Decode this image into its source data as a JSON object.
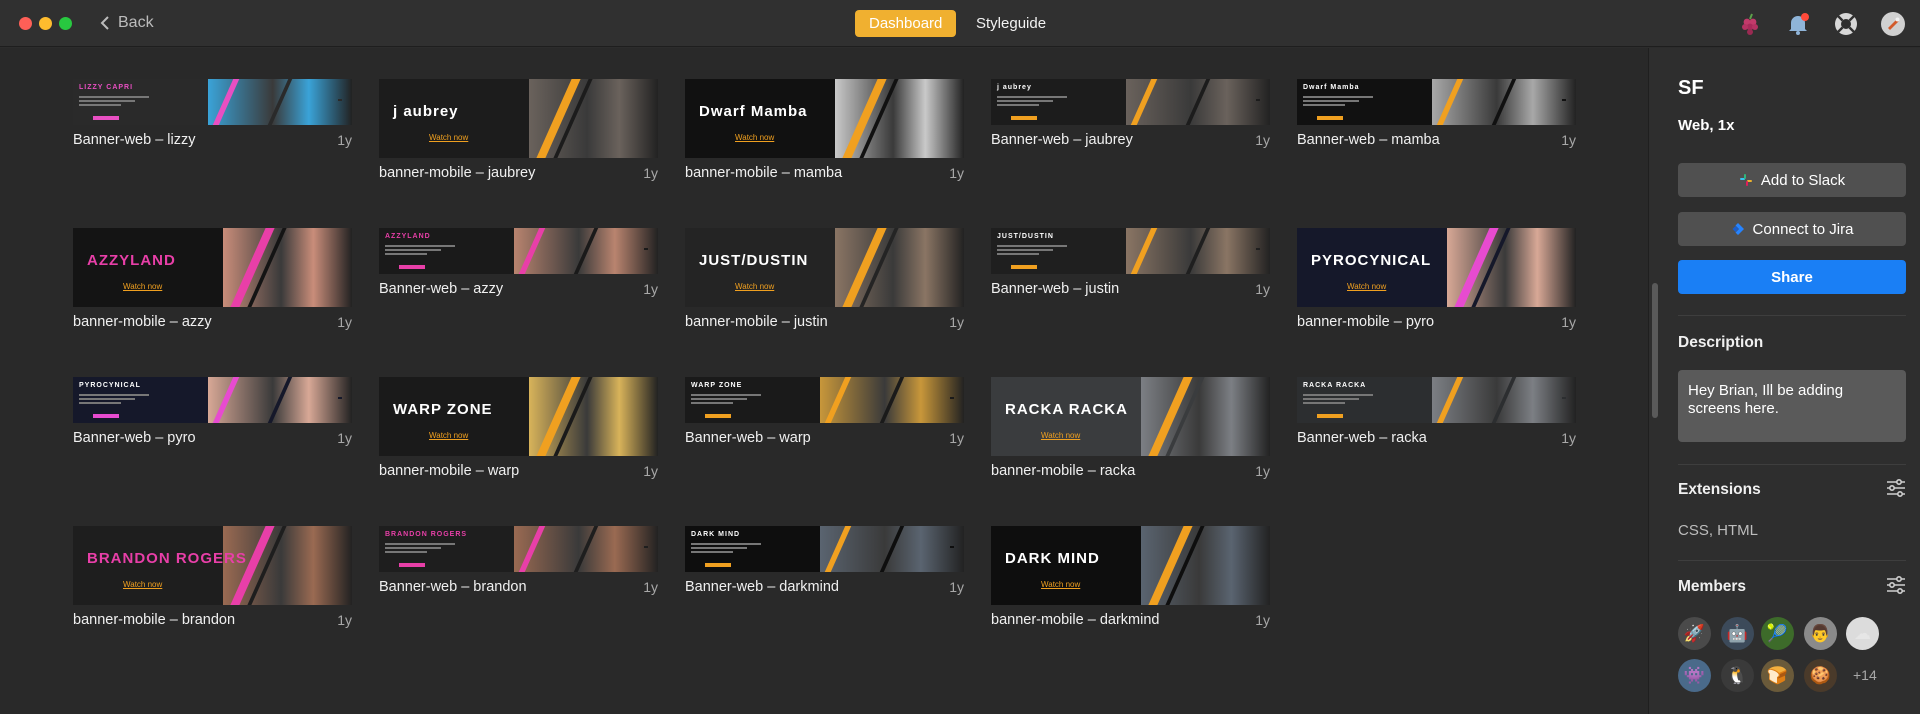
{
  "titlebar": {
    "back_label": "Back",
    "tabs": [
      {
        "label": "Dashboard",
        "active": true
      },
      {
        "label": "Styleguide",
        "active": false
      }
    ],
    "icons": [
      "grapes-icon",
      "notifications-icon",
      "help-lifebuoy-icon",
      "user-avatar-icon"
    ],
    "traffic_lights": [
      "#fe5f57",
      "#febc2e",
      "#28c840"
    ]
  },
  "grid": {
    "rows": [
      [
        {
          "name": "Banner-web – lizzy",
          "age": "1y",
          "kind": "web",
          "brand": "LIZZY CAPRI",
          "accent": "#e84fc2",
          "bg": "#2a2a2a",
          "photo": "#3aa3d8"
        },
        {
          "name": "banner-mobile – jaubrey",
          "age": "1y",
          "kind": "mobile",
          "brand": "j aubrey",
          "accent": "#f0a020",
          "bg": "#1c1c1c",
          "photo": "#6a625c",
          "watch": "Watch now"
        },
        {
          "name": "banner-mobile – mamba",
          "age": "1y",
          "kind": "mobile",
          "brand": "Dwarf Mamba",
          "accent": "#f0a020",
          "bg": "#111111",
          "photo": "#c9c9c9",
          "watch": "Watch now"
        },
        {
          "name": "Banner-web – jaubrey",
          "age": "1y",
          "kind": "web",
          "brand": "j aubrey",
          "accent": "#f0a020",
          "bg": "#1c1c1c",
          "photo": "#6a625c"
        },
        {
          "name": "Banner-web – mamba",
          "age": "1y",
          "kind": "web",
          "brand": "Dwarf Mamba",
          "accent": "#f0a020",
          "bg": "#111111",
          "photo": "#a8a8a8"
        }
      ],
      [
        {
          "name": "banner-mobile – azzy",
          "age": "1y",
          "kind": "mobile",
          "brand": "AZZYLAND",
          "accent": "#e83fa8",
          "bg": "#141414",
          "photo": "#c98d7a",
          "watch": "Watch now"
        },
        {
          "name": "Banner-web – azzy",
          "age": "1y",
          "kind": "web",
          "brand": "AZZYLAND",
          "accent": "#e83fa8",
          "bg": "#1a1a1a",
          "photo": "#b9846f"
        },
        {
          "name": "banner-mobile – justin",
          "age": "1y",
          "kind": "mobile",
          "brand": "JUST/DUSTIN",
          "accent": "#f0a020",
          "bg": "#242424",
          "photo": "#8a7564",
          "watch": "Watch now"
        },
        {
          "name": "Banner-web – justin",
          "age": "1y",
          "kind": "web",
          "brand": "JUST/DUSTIN",
          "accent": "#f0a020",
          "bg": "#1f1f1f",
          "photo": "#8a7564"
        },
        {
          "name": "banner-mobile – pyro",
          "age": "1y",
          "kind": "mobile",
          "brand": "PYROCYNICAL",
          "accent": "#e74bd0",
          "bg": "#15182a",
          "photo": "#d8a896",
          "watch": "Watch now"
        }
      ],
      [
        {
          "name": "Banner-web – pyro",
          "age": "1y",
          "kind": "web",
          "brand": "PYROCYNICAL",
          "accent": "#e74bd0",
          "bg": "#15182a",
          "photo": "#d8a896"
        },
        {
          "name": "banner-mobile – warp",
          "age": "1y",
          "kind": "mobile",
          "brand": "WARP ZONE",
          "accent": "#f0a020",
          "bg": "#1a1a1a",
          "photo": "#d8b35a",
          "watch": "Watch now"
        },
        {
          "name": "Banner-web – warp",
          "age": "1y",
          "kind": "web",
          "brand": "WARP ZONE",
          "accent": "#f0a020",
          "bg": "#1a1a1a",
          "photo": "#c8973a"
        },
        {
          "name": "banner-mobile – racka",
          "age": "1y",
          "kind": "mobile",
          "brand": "RACKA RACKA",
          "accent": "#f0a020",
          "bg": "#3a3c3e",
          "photo": "#7c7f84",
          "watch": "Watch now"
        },
        {
          "name": "Banner-web – racka",
          "age": "1y",
          "kind": "web",
          "brand": "RACKA RACKA",
          "accent": "#f0a020",
          "bg": "#2c2e30",
          "photo": "#7c7f84"
        }
      ],
      [
        {
          "name": "banner-mobile – brandon",
          "age": "1y",
          "kind": "mobile",
          "brand": "BRANDON ROGERS",
          "accent": "#e83fa8",
          "bg": "#1e1e1e",
          "photo": "#9a6a52",
          "watch": "Watch now"
        },
        {
          "name": "Banner-web – brandon",
          "age": "1y",
          "kind": "web",
          "brand": "BRANDON ROGERS",
          "accent": "#e83fa8",
          "bg": "#1e1e1e",
          "photo": "#9a6a52"
        },
        {
          "name": "Banner-web – darkmind",
          "age": "1y",
          "kind": "web",
          "brand": "DARK MIND",
          "accent": "#f0a020",
          "bg": "#0e0e0e",
          "photo": "#5a6470"
        },
        {
          "name": "banner-mobile – darkmind",
          "age": "1y",
          "kind": "mobile",
          "brand": "DARK MIND",
          "accent": "#f0a020",
          "bg": "#0e0e0e",
          "photo": "#5a6470",
          "watch": "Watch now"
        }
      ]
    ]
  },
  "sidebar": {
    "title": "SF",
    "subtitle": "Web, 1x",
    "buttons": {
      "slack": "Add to Slack",
      "jira": "Connect to Jira",
      "share": "Share"
    },
    "description_heading": "Description",
    "description_text": "Hey Brian, Ill be adding screens here.",
    "extensions_heading": "Extensions",
    "extensions_value": "CSS, HTML",
    "members_heading": "Members",
    "members": [
      {
        "icon": "rocket-icon",
        "glyph": "🚀",
        "bg": "#4a4a4a"
      },
      {
        "icon": "robot-icon",
        "glyph": "🤖",
        "bg": "#3c4a5a"
      },
      {
        "icon": "tennis-ball-icon",
        "glyph": "🎾",
        "bg": "#3d6b2a"
      },
      {
        "icon": "person-photo-icon",
        "glyph": "👨",
        "bg": "#8a8a8a"
      },
      {
        "icon": "cloud-icon",
        "glyph": "☁",
        "bg": "#dcdcdc"
      },
      {
        "icon": "alien-icon",
        "glyph": "👾",
        "bg": "#4a6a8a"
      },
      {
        "icon": "penguin-icon",
        "glyph": "🐧",
        "bg": "#3a3a3a"
      },
      {
        "icon": "bread-icon",
        "glyph": "🍞",
        "bg": "#6a5a3a"
      },
      {
        "icon": "cookie-icon",
        "glyph": "🍪",
        "bg": "#4a3a2a"
      }
    ],
    "more_members": "+14"
  }
}
